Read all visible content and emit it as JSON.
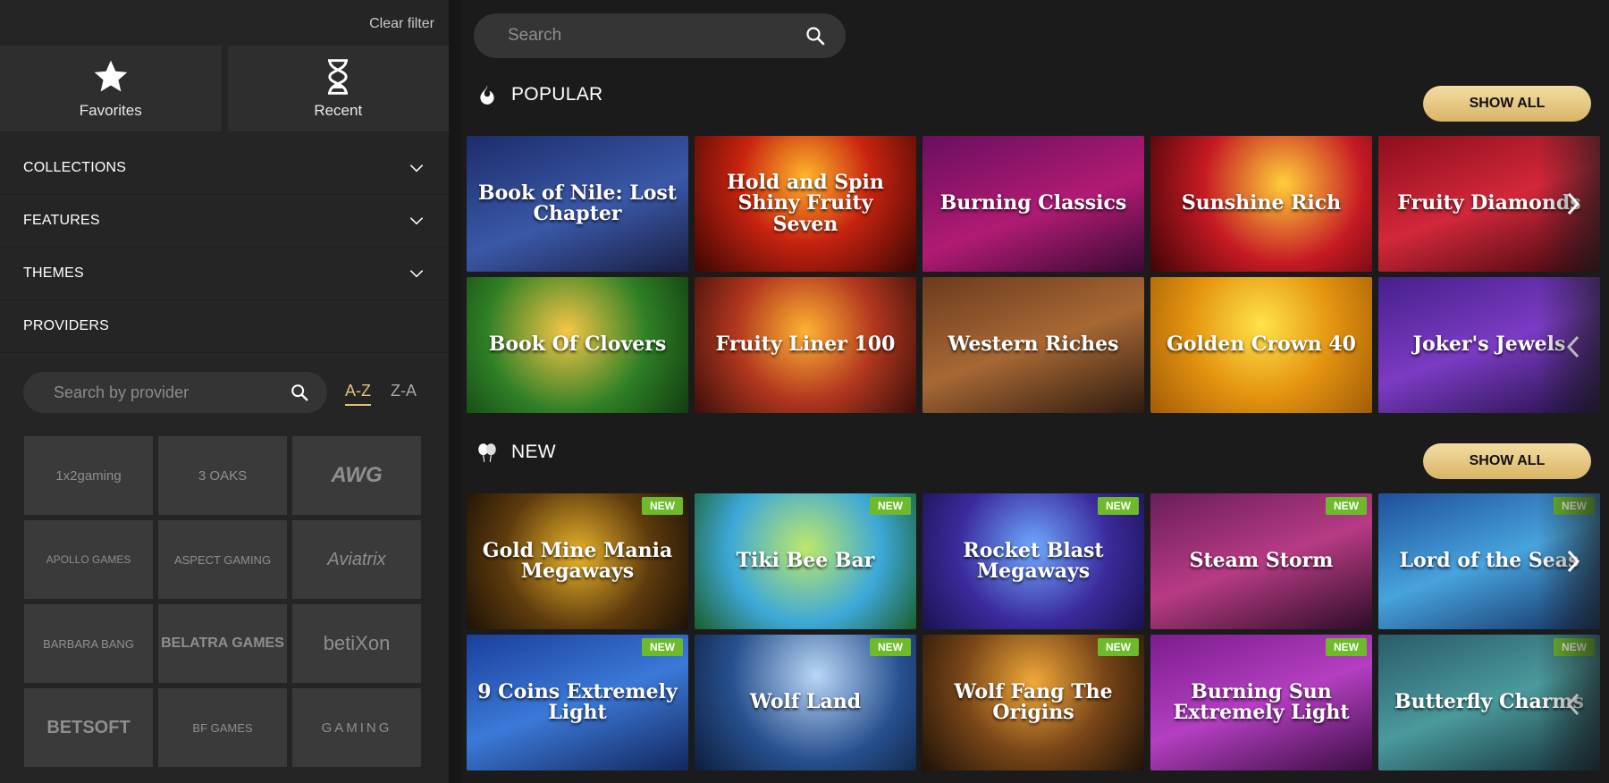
{
  "sidebar": {
    "clear_filter": "Clear filter",
    "favorites": "Favorites",
    "recent": "Recent",
    "filters": [
      "COLLECTIONS",
      "FEATURES",
      "THEMES",
      "PROVIDERS"
    ],
    "provider_search_placeholder": "Search by provider",
    "sort": [
      "A-Z",
      "Z-A"
    ],
    "providers": [
      "1x2gaming",
      "3 OAKS",
      "AWG",
      "APOLLO GAMES",
      "ASPECT GAMING",
      "Aviatrix",
      "BARBARA BANG",
      "BELATRA GAMES",
      "betiXon",
      "BETSOFT",
      "BF GAMES",
      "GAMING"
    ]
  },
  "main": {
    "search_placeholder": "Search",
    "popular": {
      "title": "POPULAR",
      "show_all": "SHOW ALL",
      "games": [
        {
          "title": "Book of Nile: Lost Chapter",
          "bg": "linear-gradient(160deg,#1d2d6b,#3a58a8 55%,#1a1f44)"
        },
        {
          "title": "Hold and Spin Shiny Fruity Seven",
          "bg": "radial-gradient(circle at 50% 30%,#ffb52b,#c8230f 45%,#3b0604)"
        },
        {
          "title": "Burning Classics",
          "bg": "linear-gradient(160deg,#6a0f5e,#b11b73 55%,#3a0a34)"
        },
        {
          "title": "Sunshine Rich",
          "bg": "radial-gradient(circle at 60% 35%,#ffcf3a,#c61a23 50%,#400407)"
        },
        {
          "title": "Fruity Diamonds",
          "bg": "linear-gradient(160deg,#8e0e1c,#d2283a 50%,#3f060d)"
        },
        {
          "title": "Book Of Clovers",
          "bg": "radial-gradient(circle at 45% 40%,#f6c646,#2e7f26 55%,#123d10)"
        },
        {
          "title": "Fruity Liner 100",
          "bg": "radial-gradient(circle at 50% 40%,#ffb231,#b2371f 50%,#3b0f0a)"
        },
        {
          "title": "Western Riches",
          "bg": "linear-gradient(160deg,#6b3b1e,#a86834 50%,#2e1b10)"
        },
        {
          "title": "Golden Crown 40",
          "bg": "radial-gradient(circle at 50% 35%,#ffe34a,#e49410 50%,#a35c06)"
        },
        {
          "title": "Joker's Jewels",
          "bg": "linear-gradient(160deg,#46208a,#7b3bc4 50%,#221046)"
        }
      ]
    },
    "new": {
      "title": "NEW",
      "show_all": "SHOW ALL",
      "badge": "NEW",
      "games": [
        {
          "title": "Gold Mine Mania Megaways",
          "bg": "radial-gradient(circle at 50% 45%,#e9b32a,#5e3b0d 55%,#1d1206)"
        },
        {
          "title": "Tiki Bee Bar",
          "bg": "radial-gradient(circle at 50% 40%,#bde86a,#3da8d8 55%,#1c5e2b)"
        },
        {
          "title": "Rocket Blast Megaways",
          "bg": "radial-gradient(circle at 50% 40%,#6fa9ff,#3b2a9c 55%,#1a1250)"
        },
        {
          "title": "Steam Storm",
          "bg": "linear-gradient(160deg,#6a1e5a,#b73b84 50%,#2e0d29)"
        },
        {
          "title": "Lord of the Seas",
          "bg": "linear-gradient(160deg,#1f4f9c,#47a3dc 50%,#123163)"
        },
        {
          "title": "9 Coins Extremely Light",
          "bg": "linear-gradient(160deg,#1b3f9b,#3b79d8 50%,#13275d)"
        },
        {
          "title": "Wolf Land",
          "bg": "radial-gradient(circle at 55% 30%,#b9d6f6,#27508e 55%,#0d1d3d)"
        },
        {
          "title": "Wolf Fang The Origins",
          "bg": "radial-gradient(circle at 50% 35%,#f0a93a,#7a4618 50%,#1d1208)"
        },
        {
          "title": "Burning Sun Extremely Light",
          "bg": "linear-gradient(160deg,#7d1c8d,#b43fc1 50%,#3c0d44)"
        },
        {
          "title": "Butterfly Charms",
          "bg": "linear-gradient(160deg,#2a5c6a,#4a9a9c 50%,#14303a)"
        }
      ]
    }
  }
}
